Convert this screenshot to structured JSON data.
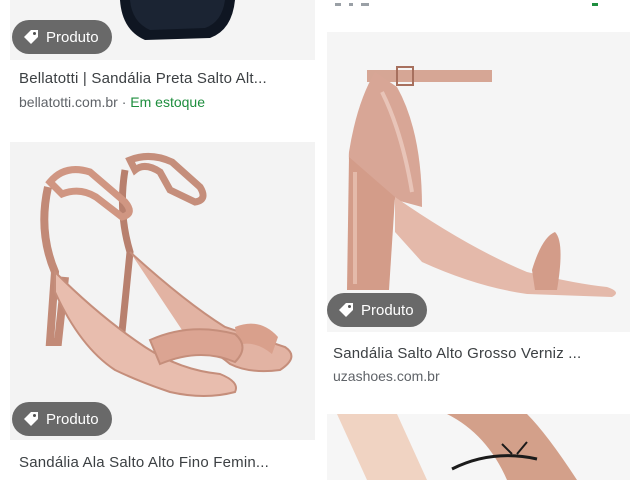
{
  "results": [
    {
      "badge": "Produto",
      "title": "Bellatotti | Sandália Preta Salto Alt...",
      "source": "bellatotti.com.br",
      "separator": " · ",
      "availability": "Em estoque"
    },
    {
      "badge": "Produto",
      "title": "Sandália Ala Salto Alto Fino Femin..."
    },
    {
      "badge": "Produto",
      "title": "Sandália Salto Alto Grosso Verniz ...",
      "source": "uzashoes.com.br"
    }
  ],
  "colors": {
    "badge_bg": "#505050",
    "stock_green": "#1e8e3e",
    "shoe_nude": "#d9a08c"
  }
}
